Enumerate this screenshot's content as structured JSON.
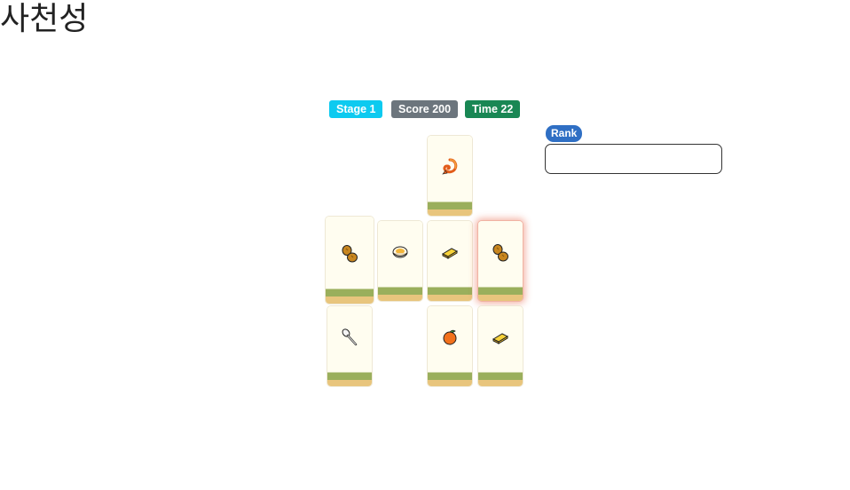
{
  "app": {
    "title": "사천성"
  },
  "status": {
    "stage_label": "Stage 1",
    "score_label": "Score 200",
    "time_label": "Time 22",
    "rank_label": "Rank",
    "rank_value": ""
  },
  "board": {
    "tiles": [
      {
        "icon": "shrimp-icon",
        "row": 0,
        "col": 2,
        "selected": false
      },
      {
        "icon": "peanut-icon",
        "row": 1,
        "col": 0,
        "selected": false
      },
      {
        "icon": "fried-egg-bowl-icon",
        "row": 1,
        "col": 1,
        "selected": false
      },
      {
        "icon": "butter-icon",
        "row": 1,
        "col": 2,
        "selected": false
      },
      {
        "icon": "peanut-icon",
        "row": 1,
        "col": 3,
        "selected": true
      },
      {
        "icon": "spoon-icon",
        "row": 2,
        "col": 0,
        "selected": false
      },
      {
        "icon": "orange-icon",
        "row": 2,
        "col": 2,
        "selected": false
      },
      {
        "icon": "butter-icon",
        "row": 2,
        "col": 3,
        "selected": false
      }
    ]
  },
  "colors": {
    "stage": "#0dcaf0",
    "score": "#6c757d",
    "time": "#198754",
    "rank": "#2f6fc4",
    "tile_face": "#fffdf0",
    "tile_green": "#9aaf5c",
    "tile_base": "#e8c57d"
  }
}
